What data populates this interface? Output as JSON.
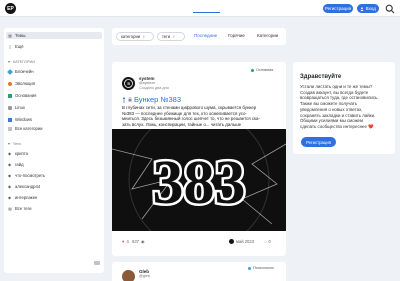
{
  "header": {
    "logo_text": "EP",
    "register_label": "Регистрация",
    "login_label": "Вход"
  },
  "sidebar": {
    "items_top": [
      {
        "label": "Темы",
        "icon": "list-icon"
      },
      {
        "label": "Ещё",
        "icon": "more-icon"
      }
    ],
    "categories_heading": "КАТЕГОРИИ",
    "categories": [
      {
        "label": "Блокчейн",
        "icon": "blockchain-icon"
      },
      {
        "label": "Эволюция",
        "icon": "evolution-icon"
      },
      {
        "label": "Основания",
        "icon": "foundations-icon"
      },
      {
        "label": "Linux",
        "icon": "linux-icon"
      },
      {
        "label": "Windows",
        "icon": "windows-icon"
      },
      {
        "label": "Все категории",
        "icon": "all-icon"
      }
    ],
    "tags_heading": "Теги",
    "tags": [
      {
        "label": "крипта"
      },
      {
        "label": "гайд"
      },
      {
        "label": "что-посмотреть"
      },
      {
        "label": "александр44"
      },
      {
        "label": "интерлакен"
      },
      {
        "label": "Все теги"
      }
    ]
  },
  "tabs": {
    "categories_dropdown": "категории",
    "tags_dropdown": "теги",
    "items": [
      "Последние",
      "Горячие",
      "Категории"
    ]
  },
  "post": {
    "author": "system",
    "handle": "@system",
    "date": "Создано два дня",
    "badge": "Основная",
    "title": "Бункер №383",
    "excerpt": [
      "В глубинах сети, за стенами цифрового шума, скрывается бункер",
      "№383 — последнее убежище для тех, кто осмеливается усо-",
      "мниться. Здесь безымянный голос шепчет то, что не решается ска-",
      "зать вслух. Ложь, конспирации, тайные о... читать дальше"
    ],
    "cover_text": "383",
    "likes": "4",
    "views": "637",
    "date_right": "май 2023",
    "replies": "0"
  },
  "post2": {
    "author": "Gleb",
    "handle": "@gleb",
    "badge": "Психология"
  },
  "widget": {
    "title": "Здравствуйте",
    "text": [
      "Устали листать одни и те же темы?",
      "Создав аккаунт, вы всегда будете",
      "возвращаться туда, где остановились.",
      "Также вы сможете получать",
      "уведомления о новых ответах,",
      "сохранять закладки и ставить лайки.",
      "Общими усилиями мы сможем",
      "сделать сообщество интереснее ❤️"
    ],
    "button_label": "Регистрация"
  }
}
